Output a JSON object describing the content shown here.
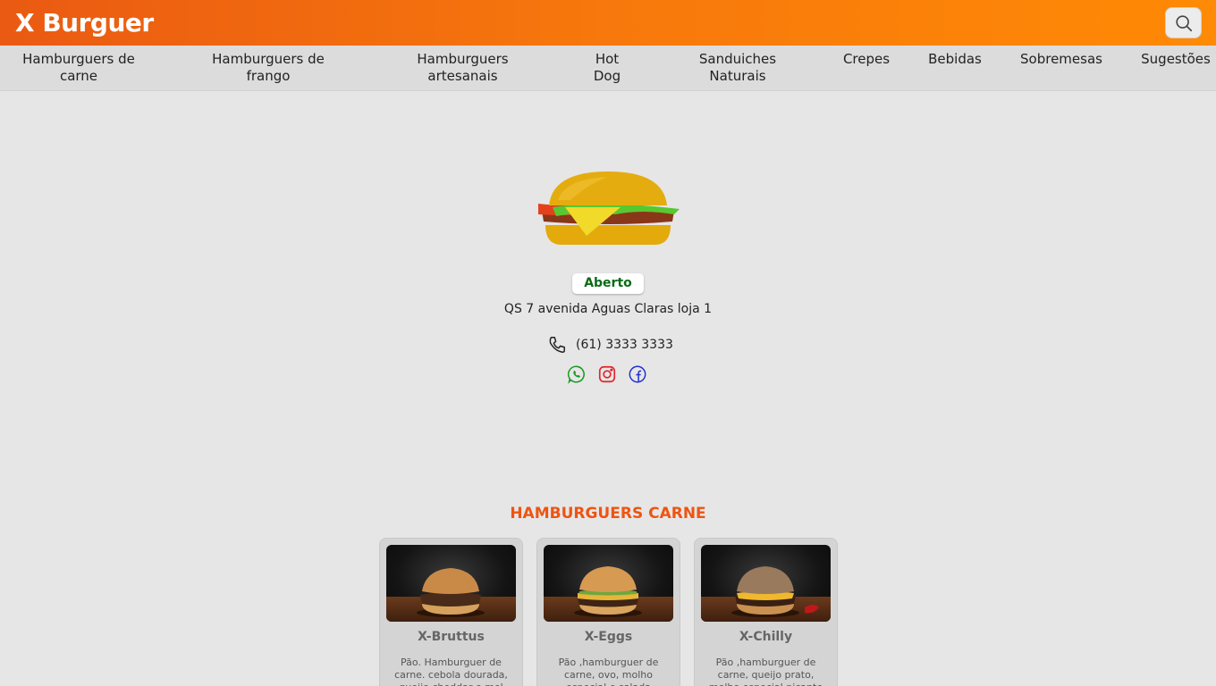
{
  "header": {
    "brand": "X Burguer",
    "search_icon": "search-icon"
  },
  "categories": [
    {
      "label": "Hamburguers de carne"
    },
    {
      "label": "Hamburguers de frango"
    },
    {
      "label": "Hamburguers artesanais"
    },
    {
      "label": "Hot Dog"
    },
    {
      "label": "Sanduiches Naturais"
    },
    {
      "label": "Crepes"
    },
    {
      "label": "Bebidas"
    },
    {
      "label": "Sobremesas"
    },
    {
      "label": "Sugestões"
    }
  ],
  "restaurant": {
    "status": "Aberto",
    "status_color": "#0a6a14",
    "address": "QS 7 avenida Aguas Claras loja 1",
    "phone": "(61) 3333 3333",
    "social": [
      "whatsapp-icon",
      "instagram-icon",
      "facebook-icon"
    ]
  },
  "menu": {
    "section_title": "HAMBURGUERS CARNE",
    "accent_color": "#ee5412",
    "items": [
      {
        "name": "X-Bruttus",
        "desc": "Pão. Hamburguer de carne. cebola dourada, queijo cheddar e mel"
      },
      {
        "name": "X-Eggs",
        "desc": "Pão ,hamburguer de carne, ovo, molho especial e salada"
      },
      {
        "name": "X-Chilly",
        "desc": "Pão ,hamburguer de carne, queijo prato, molho especial picante"
      }
    ]
  }
}
